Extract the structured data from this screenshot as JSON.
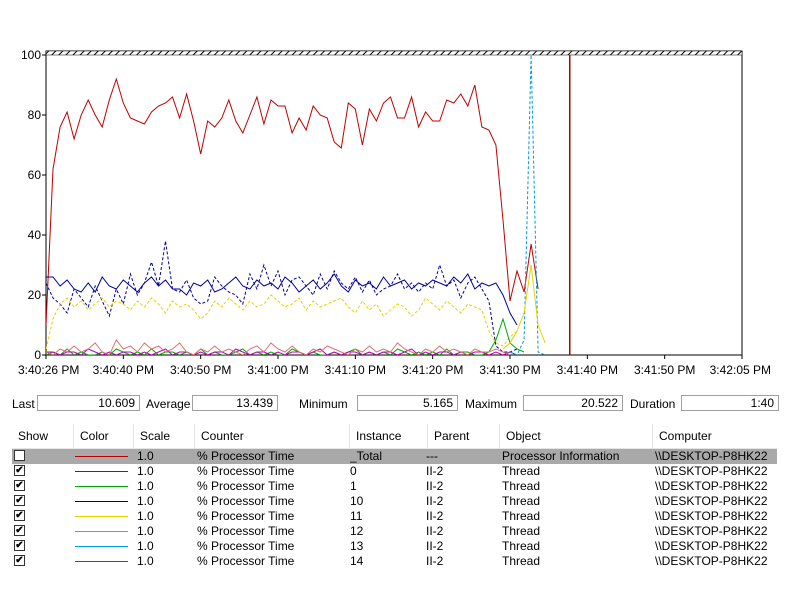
{
  "chart_data": {
    "type": "line",
    "y_ticks": [
      "100",
      "80",
      "60",
      "40",
      "20",
      "0"
    ],
    "x_ticks": [
      "3:40:26 PM",
      "3:40:40 PM",
      "3:40:50 PM",
      "3:41:00 PM",
      "3:41:10 PM",
      "3:41:20 PM",
      "3:41:30 PM",
      "3:41:40 PM",
      "3:41:50 PM",
      "3:42:05 PM"
    ],
    "ylim": [
      0,
      100
    ],
    "time_axis_seconds": [
      0,
      99
    ],
    "cursor_time_seconds": 74.5,
    "series": [
      {
        "color": "#c00000",
        "style": "solid",
        "start": 0,
        "step": 1,
        "values": [
          10,
          62,
          76,
          81,
          72,
          80,
          85,
          80,
          76,
          85,
          92,
          84,
          79,
          78,
          77,
          81,
          83,
          84,
          86,
          79,
          87,
          78,
          67,
          78,
          76,
          79,
          85,
          78,
          74,
          80,
          86,
          77,
          85,
          83,
          83,
          74,
          79,
          75,
          83,
          80,
          79,
          71,
          69,
          84,
          82,
          70,
          82,
          78,
          84,
          86,
          79,
          79,
          86,
          76,
          81,
          78,
          78,
          85,
          84,
          87,
          83,
          90,
          76,
          75,
          70,
          45,
          18,
          28,
          21,
          37,
          22
        ]
      },
      {
        "color": "#000099",
        "style": "dashed",
        "start": 0,
        "step": 1,
        "values": [
          24,
          19,
          17,
          14,
          22,
          19,
          16,
          23,
          18,
          13,
          22,
          17,
          27,
          20,
          24,
          31,
          23,
          38,
          22,
          21,
          25,
          19,
          17,
          18,
          26,
          23,
          21,
          20,
          17,
          27,
          22,
          30,
          23,
          28,
          20,
          25,
          26,
          23,
          20,
          27,
          22,
          28,
          24,
          22,
          26,
          21,
          25,
          20,
          22,
          23,
          27,
          22,
          24,
          21,
          24,
          22,
          30,
          23,
          25,
          19,
          24,
          26,
          22,
          18,
          3,
          1,
          1,
          2
        ]
      },
      {
        "color": "#000099",
        "style": "solid",
        "start": 0,
        "step": 1,
        "values": [
          26,
          26,
          23,
          25,
          22,
          21,
          24,
          21,
          26,
          23,
          22,
          25,
          23,
          21,
          24,
          26,
          23,
          25,
          22,
          22,
          20,
          24,
          23,
          25,
          21,
          22,
          24,
          26,
          23,
          22,
          25,
          23,
          24,
          22,
          26,
          24,
          21,
          23,
          25,
          22,
          24,
          27,
          23,
          21,
          25,
          23,
          24,
          22,
          26,
          23,
          24,
          25,
          22,
          24,
          23,
          25,
          24,
          23,
          26,
          24,
          27,
          22,
          24,
          23,
          24,
          20,
          14,
          10
        ]
      },
      {
        "color": "#e8d000",
        "style": "dashed",
        "start": 0,
        "step": 1,
        "values": [
          2,
          12,
          17,
          19,
          16,
          18,
          15,
          17,
          19,
          16,
          18,
          17,
          15,
          18,
          16,
          19,
          17,
          14,
          18,
          16,
          17,
          15,
          12,
          14,
          18,
          16,
          19,
          17,
          15,
          18,
          16,
          17,
          20,
          18,
          16,
          17,
          19,
          15,
          18,
          16,
          17,
          18,
          19,
          16,
          14,
          18,
          15,
          17,
          13,
          15,
          17,
          16,
          13,
          15,
          19,
          17,
          15,
          18,
          16,
          14,
          17,
          16,
          15,
          8,
          4,
          3,
          6,
          8
        ]
      },
      {
        "color": "#00aa00",
        "style": "solid",
        "start": 0,
        "step": 1,
        "values": [
          0,
          1,
          0,
          2,
          0,
          1,
          0,
          0,
          1,
          0,
          2,
          1,
          0,
          1,
          0,
          2,
          0,
          1,
          1,
          0,
          1,
          0,
          2,
          0,
          1,
          0,
          0,
          1,
          2,
          0,
          1,
          0,
          1,
          0,
          0,
          2,
          1,
          0,
          1,
          0,
          0,
          1,
          0,
          1,
          2,
          0,
          1,
          0,
          1,
          0,
          2,
          1,
          0,
          1,
          0,
          1,
          0,
          2,
          0,
          1,
          1,
          0,
          0,
          1,
          5,
          12,
          4,
          2,
          1
        ]
      },
      {
        "color": "#c000c0",
        "style": "solid",
        "start": 0,
        "step": 1,
        "values": [
          1,
          1,
          0,
          1,
          1,
          0,
          2,
          1,
          0,
          1,
          0,
          1,
          1,
          0,
          1,
          0,
          1,
          2,
          0,
          1,
          1,
          0,
          1,
          0,
          1,
          1,
          0,
          2,
          1,
          0,
          1,
          1,
          0,
          1,
          0,
          1,
          1,
          0,
          1,
          2,
          0,
          1,
          0,
          1,
          1,
          0,
          1,
          0,
          1,
          1,
          0,
          1,
          2,
          0,
          1,
          0,
          1,
          1,
          0,
          1,
          0,
          1,
          1,
          0,
          1,
          0,
          1,
          0
        ]
      },
      {
        "color": "#e07070",
        "style": "solid",
        "start": 0,
        "step": 1,
        "values": [
          1,
          0,
          2,
          1,
          3,
          1,
          2,
          4,
          1,
          0,
          5,
          2,
          3,
          1,
          4,
          2,
          3,
          1,
          2,
          4,
          1,
          0,
          2,
          1,
          3,
          1,
          2,
          1,
          0,
          2,
          3,
          1,
          4,
          2,
          1,
          3,
          1,
          0,
          2,
          1,
          3,
          2,
          1,
          0,
          2,
          1,
          3,
          1,
          2,
          1,
          4,
          2,
          1,
          0,
          2,
          1,
          3,
          1,
          2,
          1,
          0,
          2,
          1,
          1,
          2,
          1,
          0
        ]
      },
      {
        "color": "#0099dd",
        "style": "dashed",
        "start": 66,
        "step": 1,
        "values": [
          1,
          0,
          5,
          100,
          1,
          0
        ]
      },
      {
        "color": "#e8d000",
        "style": "solid",
        "start": 65,
        "step": 1,
        "values": [
          2,
          4,
          8,
          14,
          30,
          10,
          4
        ]
      }
    ]
  },
  "stats": {
    "last_label": "Last",
    "last_value": "10.609",
    "average_label": "Average",
    "average_value": "13.439",
    "minimum_label": "Minimum",
    "minimum_value": "5.165",
    "maximum_label": "Maximum",
    "maximum_value": "20.522",
    "duration_label": "Duration",
    "duration_value": "1:40"
  },
  "legend": {
    "headers": {
      "show": "Show",
      "color": "Color",
      "scale": "Scale",
      "counter": "Counter",
      "instance": "Instance",
      "parent": "Parent",
      "object": "Object",
      "computer": "Computer"
    },
    "rows": [
      {
        "checked": false,
        "selected": true,
        "color": "#c00000",
        "scale": "1.0",
        "counter": "% Processor Time",
        "instance": "_Total",
        "parent": "---",
        "object": "Processor Information",
        "computer": "\\\\DESKTOP-P8HK22"
      },
      {
        "checked": true,
        "selected": false,
        "color": "#c00000",
        "scale": "1.0",
        "counter": "% Processor Time",
        "instance": "0",
        "parent": "II-2",
        "object": "Thread",
        "computer": "\\\\DESKTOP-P8HK22"
      },
      {
        "checked": true,
        "selected": false,
        "color": "#00aa00",
        "scale": "1.0",
        "counter": "% Processor Time",
        "instance": "1",
        "parent": "II-2",
        "object": "Thread",
        "computer": "\\\\DESKTOP-P8HK22"
      },
      {
        "checked": true,
        "selected": false,
        "color": "#000099",
        "scale": "1.0",
        "counter": "% Processor Time",
        "instance": "10",
        "parent": "II-2",
        "object": "Thread",
        "computer": "\\\\DESKTOP-P8HK22"
      },
      {
        "checked": true,
        "selected": false,
        "color": "#e8d000",
        "scale": "1.0",
        "counter": "% Processor Time",
        "instance": "11",
        "parent": "II-2",
        "object": "Thread",
        "computer": "\\\\DESKTOP-P8HK22"
      },
      {
        "checked": true,
        "selected": false,
        "color": "#e07070",
        "scale": "1.0",
        "counter": "% Processor Time",
        "instance": "12",
        "parent": "II-2",
        "object": "Thread",
        "computer": "\\\\DESKTOP-P8HK22"
      },
      {
        "checked": true,
        "selected": false,
        "color": "#0099dd",
        "scale": "1.0",
        "counter": "% Processor Time",
        "instance": "13",
        "parent": "II-2",
        "object": "Thread",
        "computer": "\\\\DESKTOP-P8HK22"
      },
      {
        "checked": true,
        "selected": false,
        "color": "#c000c0",
        "scale": "1.0",
        "counter": "% Processor Time",
        "instance": "14",
        "parent": "II-2",
        "object": "Thread",
        "computer": "\\\\DESKTOP-P8HK22"
      }
    ],
    "check_glyph": "✔"
  }
}
